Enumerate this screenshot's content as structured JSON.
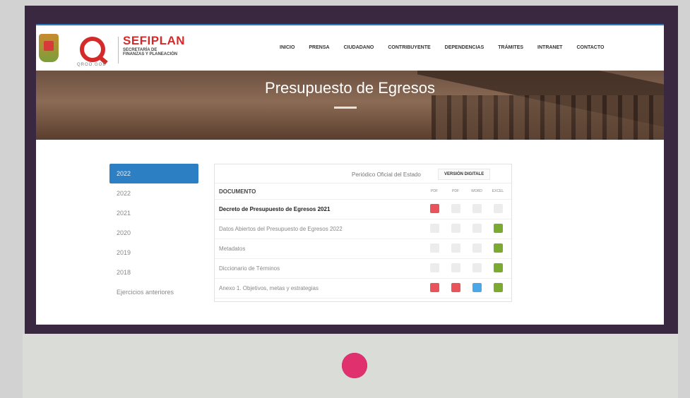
{
  "header": {
    "brand_name": "SEFIPLAN",
    "brand_sub": "SECRETARÍA DE FINANZAS Y PLANEACIÓN",
    "q_caption": "QROO.GOB"
  },
  "nav": [
    "INICIO",
    "PRENSA",
    "CIUDADANO",
    "CONTRIBUYENTE",
    "DEPENDENCIAS",
    "TRÁMITES",
    "INTRANET",
    "CONTACTO"
  ],
  "hero": {
    "title": "Presupuesto de Egresos"
  },
  "sidebar": {
    "items": [
      "2022",
      "2022",
      "2021",
      "2020",
      "2019",
      "2018",
      "Ejercicios anteriores"
    ],
    "active_index": 0
  },
  "table": {
    "periodico_label": "Periódico Oficial del Estado",
    "version_badge": "VERSIÓN DIGITALE",
    "header": {
      "doc": "DOCUMENTO",
      "cols": [
        "PDF",
        "PDF",
        "WORD",
        "EXCEL"
      ]
    },
    "rows": [
      {
        "doc": "Decreto de Presupuesto de Egresos 2021",
        "bold": true,
        "icons": [
          "red",
          "gray",
          "gray",
          "gray"
        ]
      },
      {
        "doc": "Datos Abiertos del Presupuesto de Egresos 2022",
        "bold": false,
        "icons": [
          "gray",
          "gray",
          "gray",
          "green"
        ]
      },
      {
        "doc": "Metadatos",
        "bold": false,
        "icons": [
          "gray",
          "gray",
          "gray",
          "green"
        ]
      },
      {
        "doc": "Diccionario de Términos",
        "bold": false,
        "icons": [
          "gray",
          "gray",
          "gray",
          "green"
        ]
      },
      {
        "doc": "Anexo 1. Objetivos, metas y estrategias",
        "bold": false,
        "icons": [
          "red",
          "red",
          "blue",
          "green"
        ]
      }
    ]
  },
  "colors": {
    "accent": "#2d7fc4",
    "brand": "#d52a2a",
    "frame": "#3a2840",
    "pink": "#e0306e"
  }
}
